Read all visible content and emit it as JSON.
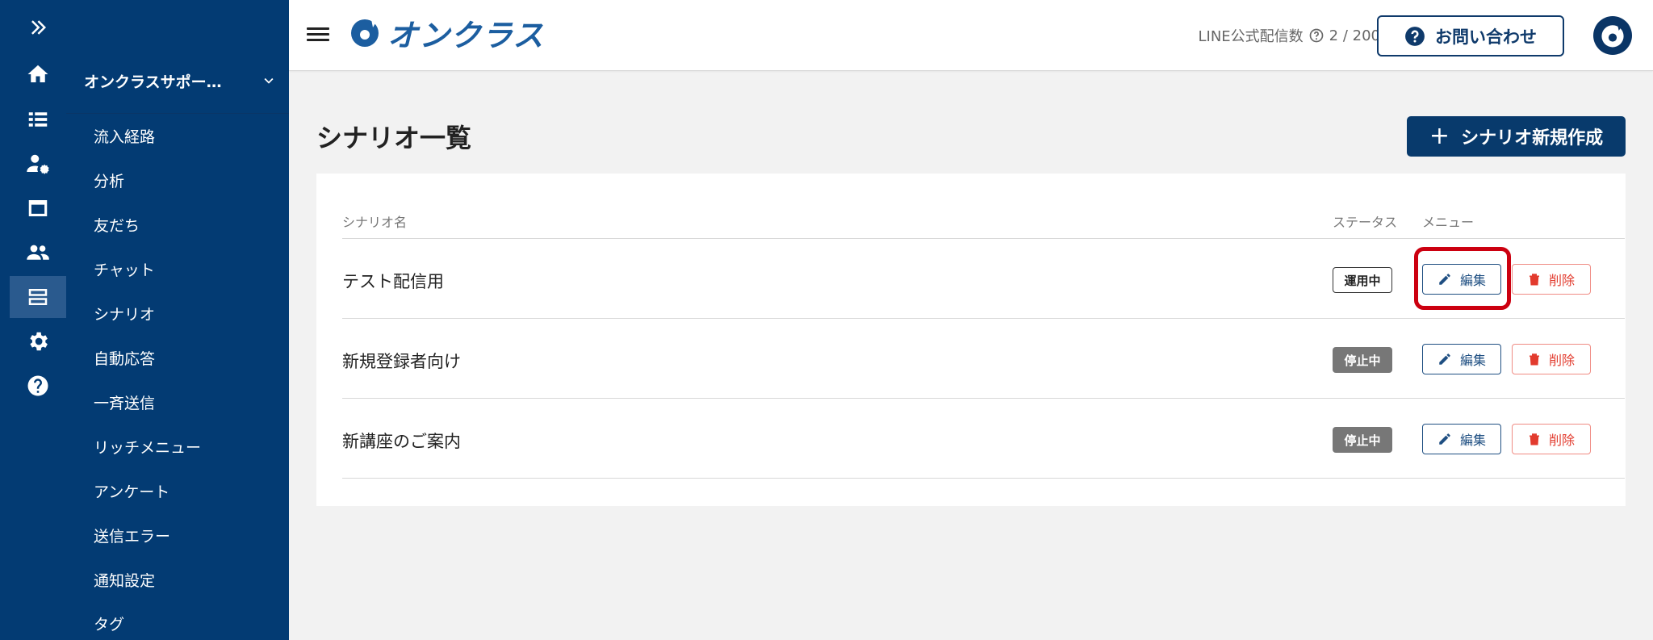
{
  "rail": {
    "items": [
      {
        "icon": "expand-icon"
      },
      {
        "icon": "home-icon"
      },
      {
        "icon": "list-icon"
      },
      {
        "icon": "user-settings-icon"
      },
      {
        "icon": "window-icon"
      },
      {
        "icon": "people-icon"
      },
      {
        "icon": "scenario-icon",
        "active": true
      },
      {
        "icon": "gear-icon"
      },
      {
        "icon": "help-icon"
      }
    ]
  },
  "sidebar": {
    "account_name": "オンクラスサポー…",
    "items": [
      {
        "label": "流入経路"
      },
      {
        "label": "分析"
      },
      {
        "label": "友だち"
      },
      {
        "label": "チャット"
      },
      {
        "label": "シナリオ"
      },
      {
        "label": "自動応答"
      },
      {
        "label": "一斉送信"
      },
      {
        "label": "リッチメニュー"
      },
      {
        "label": "アンケート"
      },
      {
        "label": "送信エラー"
      },
      {
        "label": "通知設定"
      },
      {
        "label": "タグ"
      }
    ]
  },
  "header": {
    "logo_text": "オンクラス",
    "quota_label": "LINE公式配信数",
    "quota_value": "2 / 200",
    "contact_label": "お問い合わせ"
  },
  "main": {
    "page_title": "シナリオ一覧",
    "new_button_label": "シナリオ新規作成",
    "columns": {
      "name": "シナリオ名",
      "status": "ステータス",
      "menu": "メニュー"
    },
    "rows": [
      {
        "name": "テスト配信用",
        "status": "運用中",
        "status_type": "active",
        "edit": "編集",
        "delete": "削除"
      },
      {
        "name": "新規登録者向け",
        "status": "停止中",
        "status_type": "stopped",
        "edit": "編集",
        "delete": "削除"
      },
      {
        "name": "新講座のご案内",
        "status": "停止中",
        "status_type": "stopped",
        "edit": "編集",
        "delete": "削除"
      }
    ]
  },
  "colors": {
    "sidebar_bg": "#033b73",
    "primary": "#083a6c",
    "danger": "#e23b2e",
    "highlight": "#cc0010"
  }
}
